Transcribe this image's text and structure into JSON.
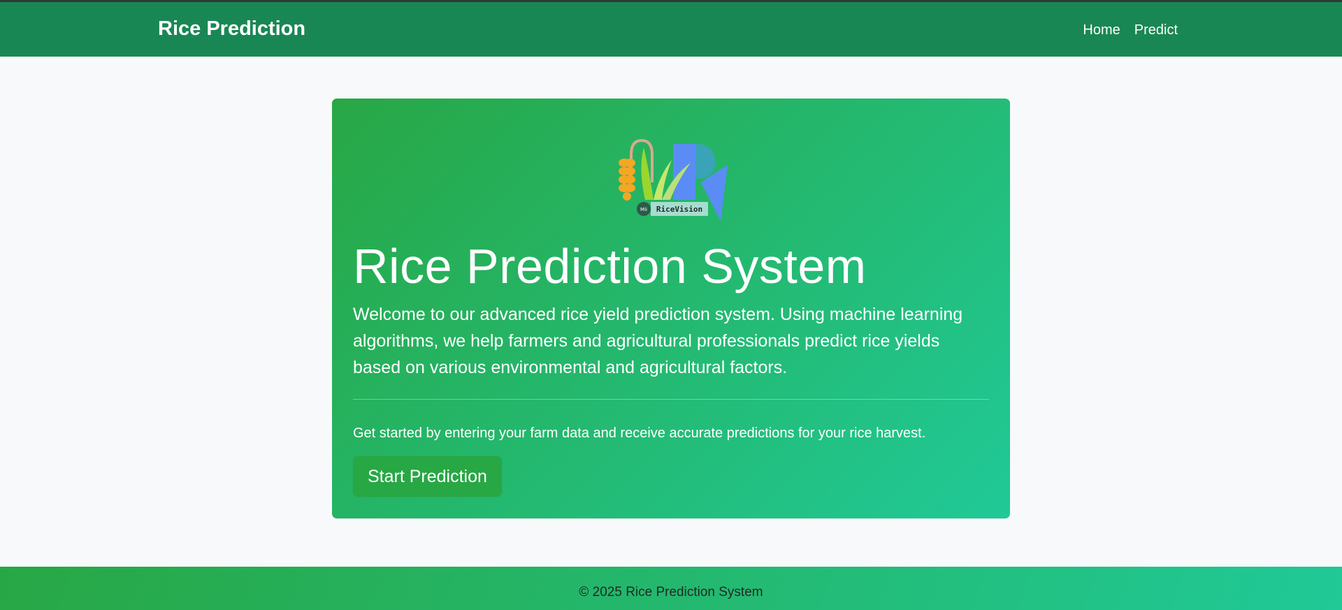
{
  "navbar": {
    "brand": "Rice Prediction",
    "links": [
      "Home",
      "Predict"
    ],
    "background": "#198754"
  },
  "hero": {
    "logo": {
      "badge_text": "RiceVision",
      "circle_text": "Mii"
    },
    "title": "Rice Prediction System",
    "lead": "Welcome to our advanced rice yield prediction system. Using machine learning algorithms, we help farmers and agricultural professionals predict rice yields based on various environmental and agricultural factors.",
    "text": "Get started by entering your farm data and receive accurate predictions for your rice harvest.",
    "button_label": "Start Prediction",
    "gradient_start": "#28a745",
    "gradient_end": "#20c997"
  },
  "footer": {
    "text": "© 2025 Rice Prediction System"
  }
}
